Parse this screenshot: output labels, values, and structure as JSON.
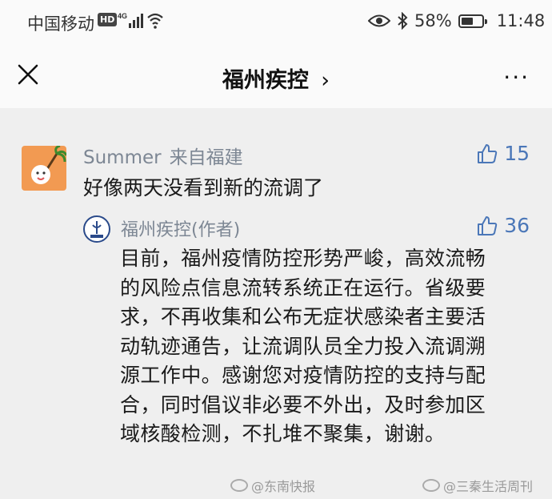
{
  "status_bar": {
    "carrier": "中国移动",
    "hd": "HD",
    "network": "4G",
    "battery": "58%",
    "battery_level": 0.58,
    "time": "11:48"
  },
  "nav": {
    "title": "福州疾控",
    "chevron": "›",
    "more": "···"
  },
  "comment": {
    "user": "Summer",
    "location": "来自福建",
    "likes": "15",
    "text": "好像两天没看到新的流调了"
  },
  "reply": {
    "user": "福州疾控(作者)",
    "likes": "36",
    "lines": [
      "目前，福州疫情防控形势严峻，高效流畅",
      "的风险点信息流转系统正在运行。省级要",
      "求，不再收集和公布无症状感染者主要活",
      "动轨迹通告，让流调队员全力投入流调溯",
      "源工作中。感谢您对疫情防控的支持与配",
      "合，同时倡议非必要不外出，及时参加区",
      "域核酸检测，不扎堆不聚集，谢谢。"
    ]
  },
  "watermarks": {
    "left": "@东南快报",
    "right": "@三秦生活周刊"
  },
  "icons": {
    "close": "close-icon",
    "more": "more-icon",
    "like": "thumbs-up-icon",
    "eye": "eye-icon",
    "bluetooth": "bluetooth-icon",
    "wifi": "wifi-icon"
  },
  "colors": {
    "accent": "#4b77b8",
    "meta": "#7d8794",
    "avatar": "#f29a52"
  }
}
